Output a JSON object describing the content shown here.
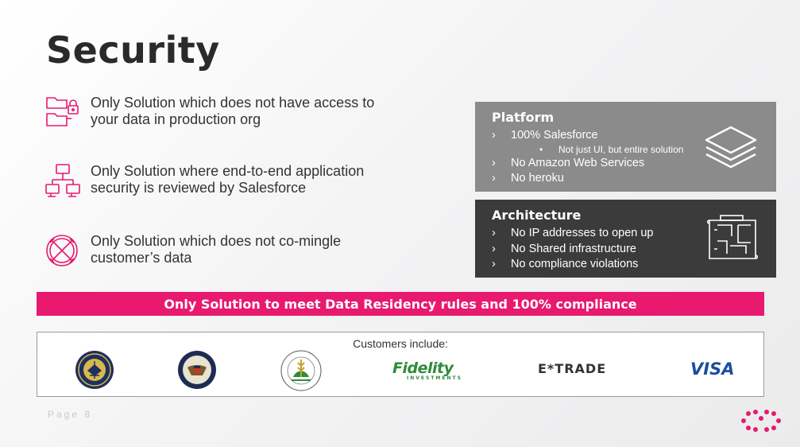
{
  "slide": {
    "title": "Security",
    "page_label": "Page 8"
  },
  "features": [
    {
      "icon": "locked-folders-icon",
      "text": "Only Solution which does not have access to your data in production org"
    },
    {
      "icon": "hierarchy-network-icon",
      "text": "Only Solution where end-to-end application security is reviewed by Salesforce"
    },
    {
      "icon": "crossed-circle-icon",
      "text": "Only Solution which does not co-mingle customer’s data"
    }
  ],
  "platform": {
    "title": "Platform",
    "bullet_glyph": "›",
    "sub_bullet_glyph": "•",
    "items": [
      {
        "text": "100% Salesforce",
        "sub": "Not just UI, but entire solution"
      },
      {
        "text": "No Amazon Web Services"
      },
      {
        "text": "No heroku"
      }
    ],
    "icon": "stacked-layers-icon",
    "color": "#8b8b8b"
  },
  "architecture": {
    "title": "Architecture",
    "items": [
      {
        "text": "No IP addresses to open up"
      },
      {
        "text": "No Shared infrastructure"
      },
      {
        "text": "No compliance violations"
      }
    ],
    "icon": "floor-plan-icon",
    "color": "#3b3b3b"
  },
  "banner": {
    "text": "Only Solution to meet Data Residency rules and 100% compliance",
    "color": "#e8196f"
  },
  "customers": {
    "label": "Customers include:",
    "logos": [
      {
        "name": "united-states-navy-seal-icon"
      },
      {
        "name": "department-of-state-seal-icon"
      },
      {
        "name": "department-of-agriculture-seal-icon"
      },
      {
        "name": "Fidelity",
        "sub": "INVESTMENTS"
      },
      {
        "name": "E*TRADE"
      },
      {
        "name": "VISA"
      }
    ]
  },
  "brand_icon": "brand-dots-logo-icon"
}
